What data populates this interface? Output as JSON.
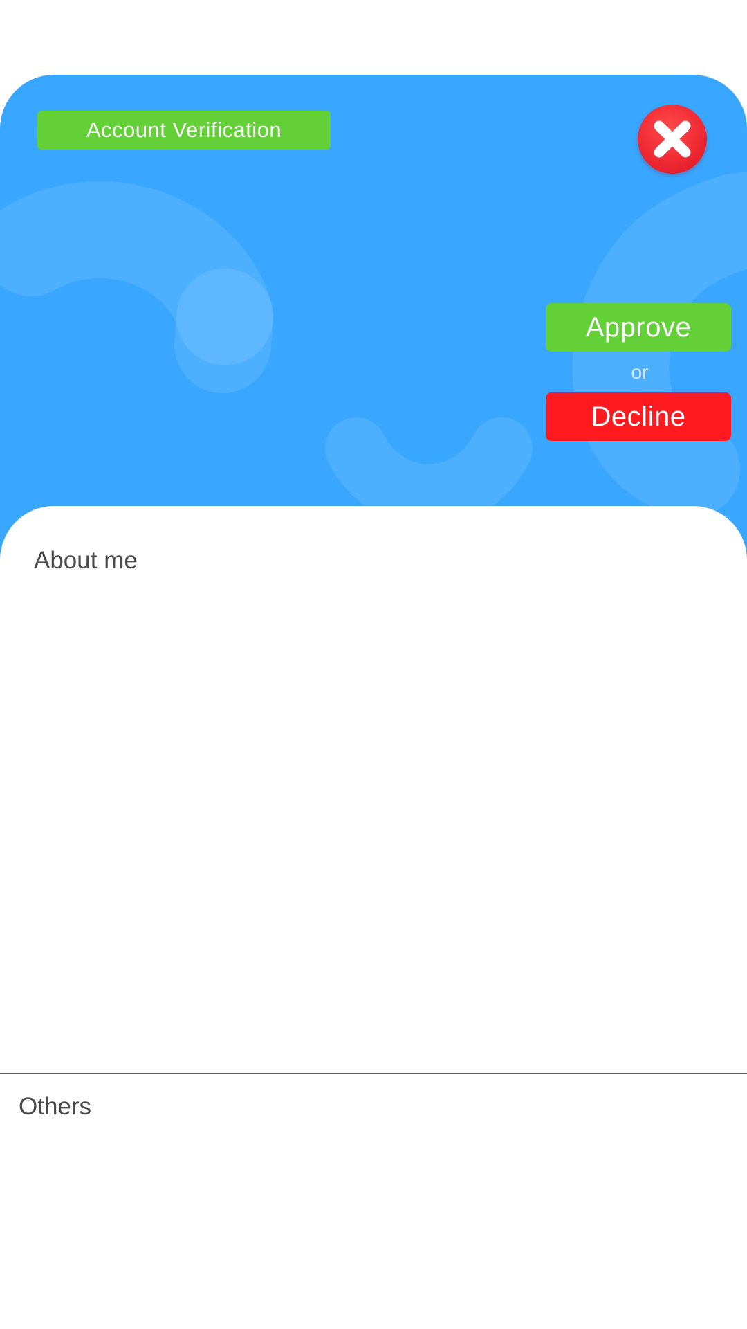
{
  "header": {
    "verification_badge": "Account Verification",
    "close_icon": "close-x-icon",
    "approve_label": "Approve",
    "or_label": "or",
    "decline_label": "Decline"
  },
  "content": {
    "about_title": "About me",
    "others_title": "Others"
  },
  "colors": {
    "header_background": "#39a7ff",
    "badge_green": "#63d037",
    "approve_green": "#63d037",
    "decline_red": "#ff1a1f",
    "close_red": "#ef2a33",
    "heading_text": "#4a4a4a"
  }
}
